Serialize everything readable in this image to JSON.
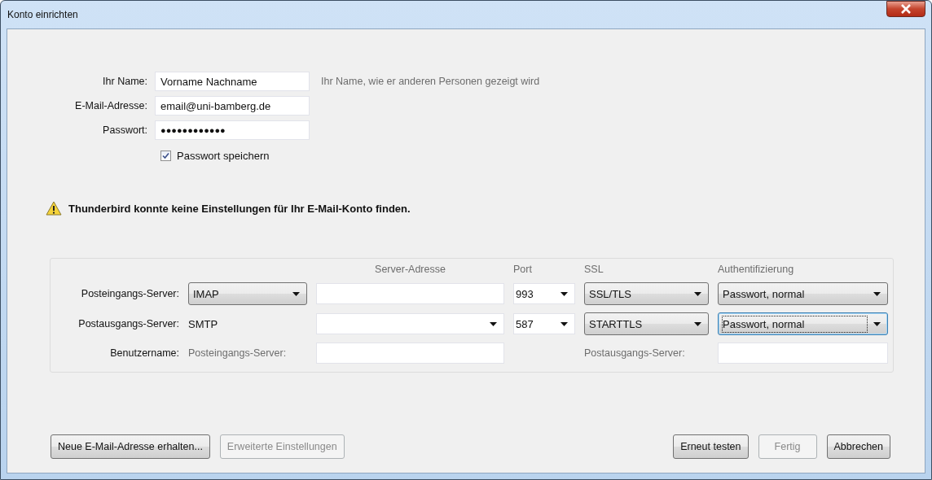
{
  "window": {
    "title": "Konto einrichten"
  },
  "fields": [
    {
      "label": "Ihr Name:",
      "value": "Vorname Nachname",
      "hint": "Ihr Name, wie er anderen Personen gezeigt wird"
    },
    {
      "label": "E-Mail-Adresse:",
      "value": "email@uni-bamberg.de"
    },
    {
      "label": "Passwort:",
      "value": "●●●●●●●●●●●●"
    }
  ],
  "remember_password": {
    "label": "Passwort speichern",
    "checked": true
  },
  "warning": {
    "text": "Thunderbird konnte keine Einstellungen für Ihr E-Mail-Konto finden."
  },
  "server_settings": {
    "columns": [
      "Server-Adresse",
      "Port",
      "SSL",
      "Authentifizierung"
    ],
    "rows": [
      {
        "label": "Posteingangs-Server:",
        "type": {
          "kind": "dropdown",
          "value": "IMAP"
        },
        "address": {
          "kind": "field"
        },
        "port": "993",
        "ssl": "SSL/TLS",
        "auth": "Passwort, normal",
        "auth_focused": false
      },
      {
        "label": "Postausgangs-Server:",
        "type": {
          "kind": "text",
          "value": "SMTP"
        },
        "address": {
          "kind": "combo"
        },
        "port": "587",
        "ssl": "STARTTLS",
        "auth": "Passwort, normal",
        "auth_focused": true
      }
    ],
    "username": {
      "label": "Benutzername:",
      "incoming_label": "Posteingangs-Server:",
      "outgoing_label": "Postausgangs-Server:"
    }
  },
  "buttons_left": [
    {
      "label": "Neue E-Mail-Adresse erhalten...",
      "disabled": false
    },
    {
      "label": "Erweiterte Einstellungen",
      "disabled": true
    }
  ],
  "buttons_right": [
    {
      "label": "Erneut testen",
      "disabled": false
    },
    {
      "label": "Fertig",
      "disabled": true
    },
    {
      "label": "Abbrechen",
      "disabled": false
    }
  ]
}
